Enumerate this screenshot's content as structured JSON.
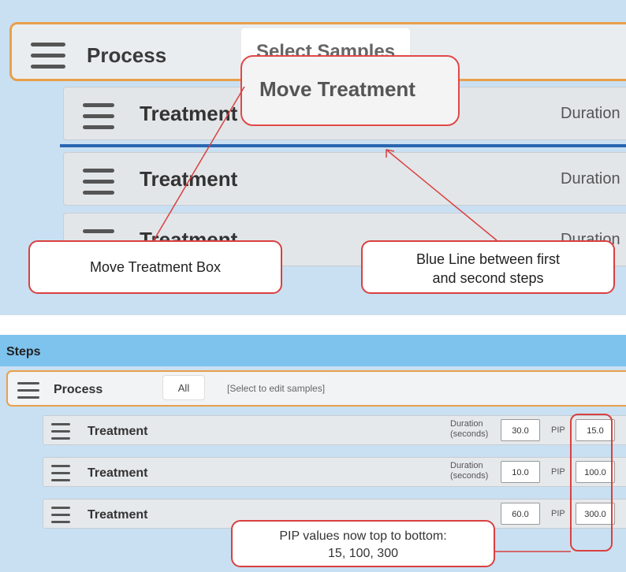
{
  "top": {
    "process_label": "Process",
    "select_samples": "Select Samples",
    "move_treatment": "Move Treatment",
    "rows": [
      {
        "label": "Treatment",
        "duration": "Duration"
      },
      {
        "label": "Treatment",
        "duration": "Duration"
      },
      {
        "label": "Treatment",
        "duration": "Duration"
      }
    ],
    "callouts": {
      "move_box": "Move Treatment Box",
      "blue_line_1": "Blue Line between first",
      "blue_line_2": "and second steps"
    },
    "colors": {
      "blue_line": "#2a66b0",
      "callout_border": "#d94040",
      "process_border": "#e8a04a"
    }
  },
  "bottom": {
    "header": "Steps",
    "process_label": "Process",
    "all_button": "All",
    "edit_samples": "[Select to edit samples]",
    "duration_label_1": "Duration",
    "duration_label_2": "(seconds)",
    "pip_label": "PIP",
    "rows": [
      {
        "label": "Treatment",
        "duration": "30.0",
        "pip": "15.0"
      },
      {
        "label": "Treatment",
        "duration": "10.0",
        "pip": "100.0"
      },
      {
        "label": "Treatment",
        "duration": "60.0",
        "pip": "300.0"
      }
    ],
    "callout_pip_1": "PIP values now top to bottom:",
    "callout_pip_2": "15, 100, 300"
  }
}
